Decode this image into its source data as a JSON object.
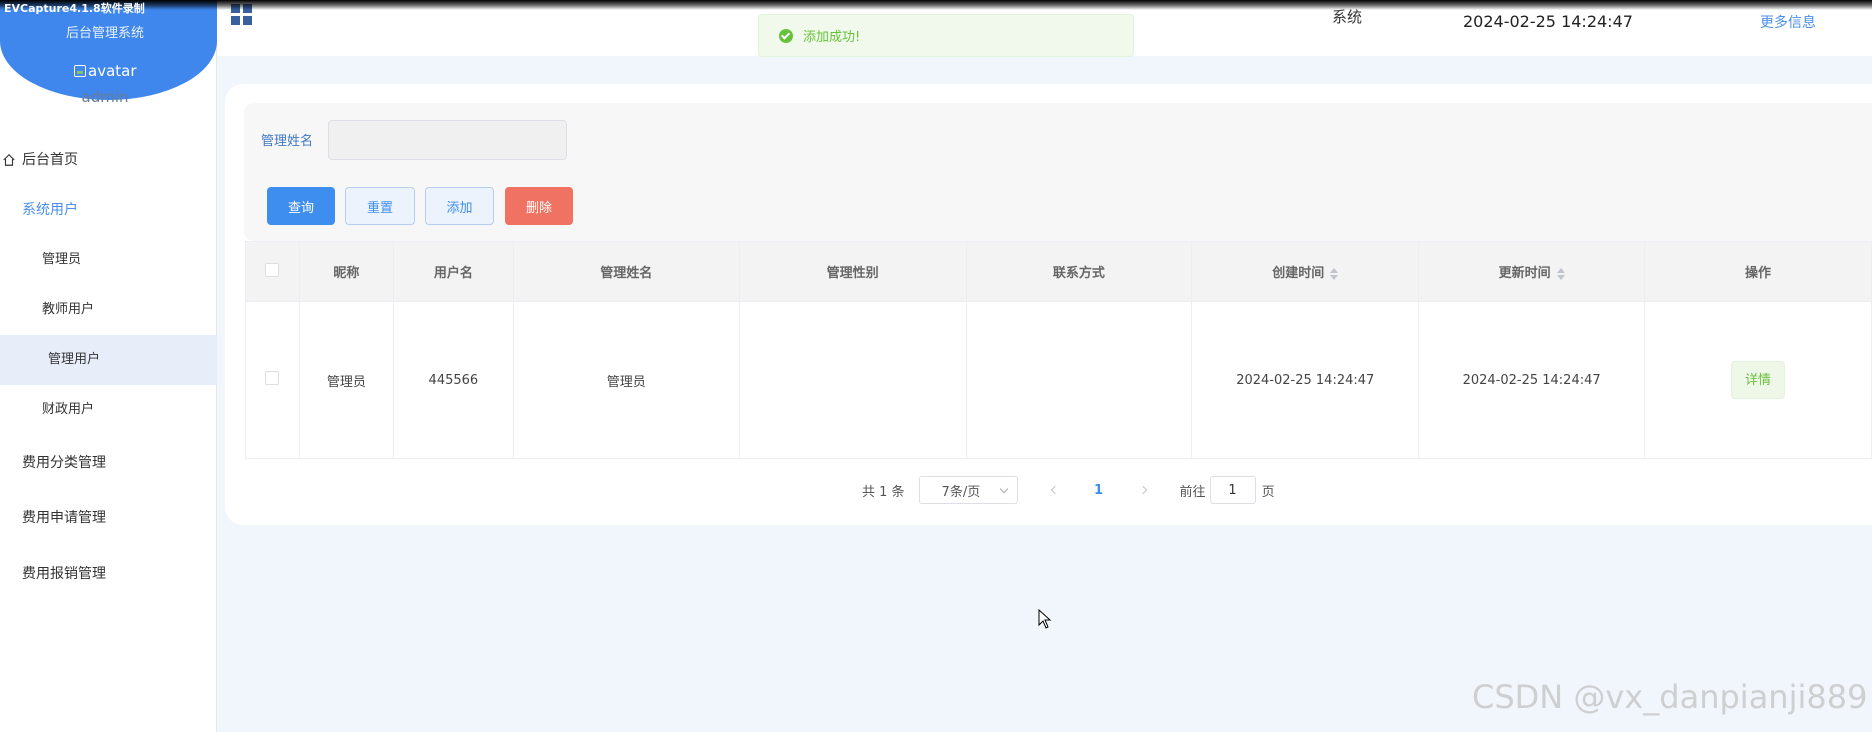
{
  "recording_label": "EVCapture4.1.8软件录制",
  "sidebar": {
    "system_title": "后台管理系统",
    "avatar_alt": "avatar",
    "username": "admin",
    "menu": [
      {
        "label": "后台首页"
      },
      {
        "label": "系统用户"
      },
      {
        "label": "管理员"
      },
      {
        "label": "教师用户"
      },
      {
        "label": "管理用户"
      },
      {
        "label": "财政用户"
      },
      {
        "label": "费用分类管理"
      },
      {
        "label": "费用申请管理"
      },
      {
        "label": "费用报销管理"
      }
    ]
  },
  "header": {
    "title_fragment": "系统",
    "datetime": "2024-02-25 14:24:47",
    "more_info": "更多信息"
  },
  "toast": {
    "message": "添加成功!"
  },
  "search": {
    "label": "管理姓名",
    "value": ""
  },
  "buttons": {
    "query": "查询",
    "reset": "重置",
    "add": "添加",
    "delete": "删除"
  },
  "table": {
    "headers": [
      "昵称",
      "用户名",
      "管理姓名",
      "管理性别",
      "联系方式",
      "创建时间",
      "更新时间",
      "操作"
    ],
    "rows": [
      {
        "nickname": "管理员",
        "username": "445566",
        "admin_name": "管理员",
        "gender": "",
        "contact": "",
        "created": "2024-02-25 14:24:47",
        "updated": "2024-02-25 14:24:47",
        "action": "详情"
      }
    ]
  },
  "pagination": {
    "total": "共 1 条",
    "page_size": "7条/页",
    "current": "1",
    "goto_label": "前往",
    "goto_value": "1",
    "goto_unit": "页"
  },
  "watermark": "CSDN @vx_danpianji889",
  "colors": {
    "primary": "#3e8ef0",
    "danger": "#f07262",
    "success": "#67c23a",
    "sidebar_head": "#3f87ec"
  }
}
